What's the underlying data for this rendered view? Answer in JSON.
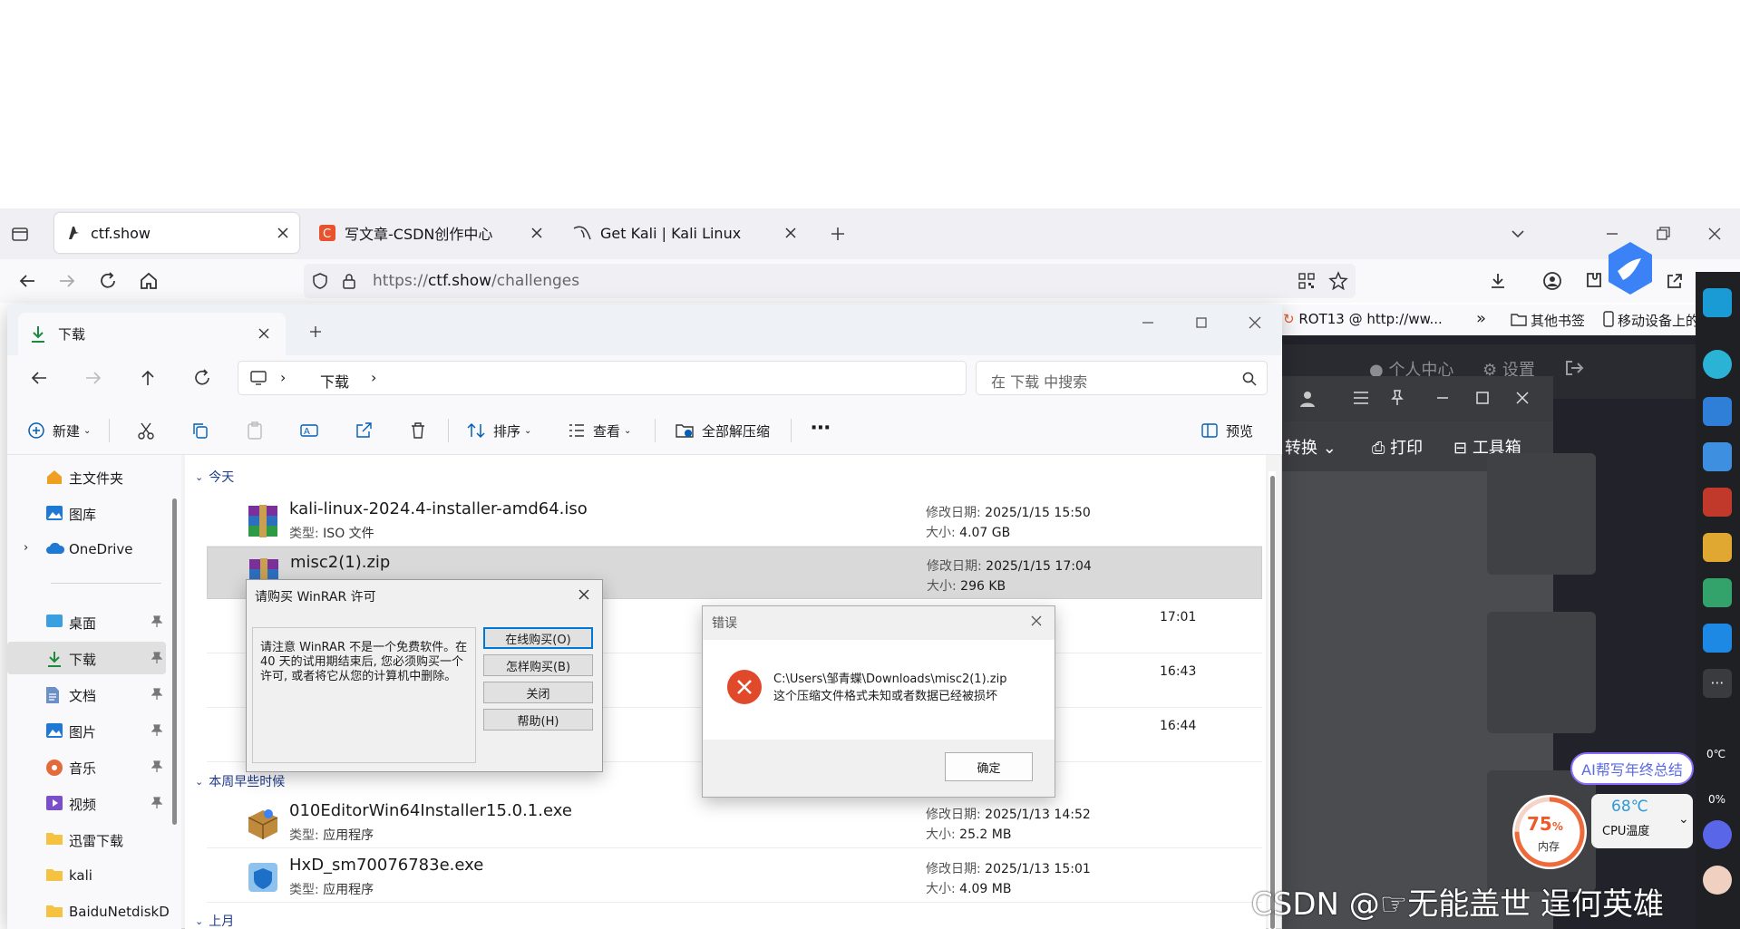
{
  "browser": {
    "tabs": [
      {
        "label": "ctf.show",
        "active": true
      },
      {
        "label": "写文章-CSDN创作中心",
        "active": false
      },
      {
        "label": "Get Kali | Kali Linux",
        "active": false
      }
    ],
    "url_prefix": "https://",
    "url_host": "ctf.show",
    "url_path": "/challenges",
    "bookmarks": [
      "ROT13 @ http://ww...",
      "其他书签",
      "移动设备上的"
    ]
  },
  "web_page": {
    "top_links": [
      "个人中心",
      "设置"
    ],
    "reader_buttons": [
      "转换",
      "打印",
      "工具箱"
    ]
  },
  "explorer": {
    "tab_title": "下载",
    "breadcrumb": [
      "下载"
    ],
    "search_placeholder": "在 下载 中搜索",
    "toolbar": {
      "new": "新建",
      "sort": "排序",
      "view": "查看",
      "extract_all": "全部解压缩",
      "preview": "预览"
    },
    "nav_items": [
      {
        "label": "主文件夹"
      },
      {
        "label": "图库"
      },
      {
        "label": "OneDrive"
      },
      {
        "label": "桌面"
      },
      {
        "label": "下载"
      },
      {
        "label": "文档"
      },
      {
        "label": "图片"
      },
      {
        "label": "音乐"
      },
      {
        "label": "视频"
      },
      {
        "label": "迅雷下载"
      },
      {
        "label": "kali"
      },
      {
        "label": "BaiduNetdiskD"
      }
    ],
    "groups": [
      "今天",
      "本周早些时候",
      "上月"
    ],
    "labels": {
      "modified": "修改日期:",
      "size": "大小:",
      "type": "类型:"
    },
    "files_today": [
      {
        "name": "kali-linux-2024.4-installer-amd64.iso",
        "type": "ISO 文件",
        "modified": "2025/1/15 15:50",
        "size": "4.07 GB"
      },
      {
        "name": "misc2(1).zip",
        "type": "",
        "modified": "2025/1/15 17:04",
        "size": "296 KB"
      },
      {
        "name": "",
        "type": "",
        "modified": "17:01",
        "size": ""
      },
      {
        "name": "",
        "type": "",
        "modified": "16:43",
        "size": ""
      },
      {
        "name": "",
        "type": "",
        "modified": "16:44",
        "size": ""
      }
    ],
    "files_week": [
      {
        "name": "010EditorWin64Installer15.0.1.exe",
        "type": "应用程序",
        "modified": "2025/1/13 14:52",
        "size": "25.2 MB"
      },
      {
        "name": "HxD_sm70076783e.exe",
        "type": "应用程序",
        "modified": "2025/1/13 15:01",
        "size": "4.09 MB"
      }
    ]
  },
  "winrar_dialog": {
    "title": "请购买 WinRAR 许可",
    "message": "请注意 WinRAR 不是一个免费软件。在 40 天的试用期结束后, 您必须购买一个许可, 或者将它从您的计算机中删除。",
    "buttons": [
      "在线购买(O)",
      "怎样购买(B)",
      "关闭",
      "帮助(H)"
    ]
  },
  "error_dialog": {
    "title": "错误",
    "path": "C:\\Users\\邹青蝶\\Downloads\\misc2(1).zip",
    "message": "这个压缩文件格式未知或者数据已经被损坏",
    "ok": "确定"
  },
  "widgets": {
    "ai_badge": "AI帮写年终总结",
    "memory_value": "75",
    "memory_unit": "%",
    "memory_label": "内存",
    "cpu_temp": "68℃",
    "cpu_label": "CPU温度",
    "sidebar_readings": [
      "0℃",
      "0%"
    ],
    "memory_fraction": 0.75
  },
  "watermark": "CSDN @☞无能盖世 逞何英雄",
  "colors": {
    "accent": "#005fb8",
    "error": "#e04a2a",
    "folder": "#f5c342"
  }
}
